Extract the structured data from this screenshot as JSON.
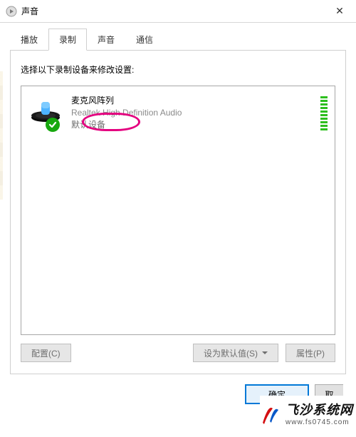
{
  "window": {
    "title": "声音",
    "close_glyph": "✕"
  },
  "tabs": {
    "playback": "播放",
    "recording": "录制",
    "sounds": "声音",
    "communications": "通信",
    "active": "recording"
  },
  "instruction": "选择以下录制设备来修改设置:",
  "device": {
    "name": "麦克风阵列",
    "driver": "Realtek High Definition Audio",
    "status": "默认设备",
    "level_bars": 10
  },
  "buttons": {
    "configure": "配置(C)",
    "set_default": "设为默认值(S)",
    "properties": "属性(P)",
    "ok": "确定",
    "cancel_cut": "取"
  },
  "watermark": {
    "line1": "飞沙系统网",
    "line2": "www.fs0745.com"
  }
}
